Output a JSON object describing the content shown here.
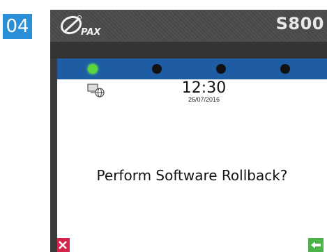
{
  "step": {
    "number": "04"
  },
  "device": {
    "brand": "PAX",
    "model": "S800",
    "colors": {
      "accent": "#1e5da3",
      "led_on": "#5bd63c",
      "badge": "#2a8fd6"
    }
  },
  "status": {
    "leds": [
      {
        "state": "on"
      },
      {
        "state": "off"
      },
      {
        "state": "off"
      },
      {
        "state": "off"
      }
    ],
    "network_icon": "network-globe-icon"
  },
  "clock": {
    "time": "12:30",
    "date": "26/07/2016"
  },
  "dialog": {
    "message": "Perform Software Rollback?"
  },
  "softkeys": {
    "cancel_icon": "cancel-x-icon",
    "enter_icon": "enter-arrow-icon"
  }
}
